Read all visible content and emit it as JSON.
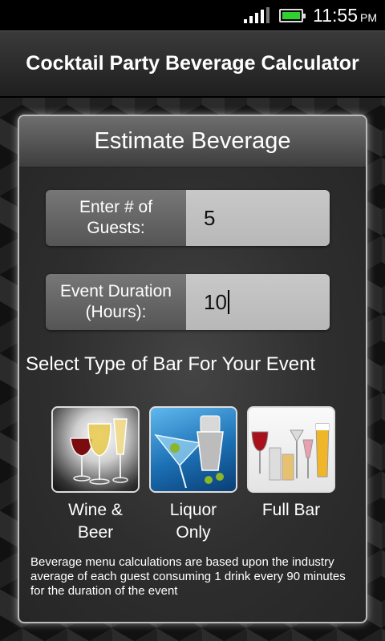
{
  "status_bar": {
    "time": "11:55",
    "ampm": "PM"
  },
  "app": {
    "title": "Cocktail Party Beverage Calculator"
  },
  "panel": {
    "header": "Estimate Beverage",
    "guests": {
      "label_line1": "Enter # of",
      "label_line2": "Guests:",
      "value": "5"
    },
    "duration": {
      "label_line1": "Event Duration",
      "label_line2": "(Hours):",
      "value": "10"
    },
    "section_heading": "Select Type of Bar For Your Event",
    "bar_options": [
      {
        "line1": "Wine &",
        "line2": "Beer"
      },
      {
        "line1": "Liquor",
        "line2": "Only"
      },
      {
        "line1": "Full Bar",
        "line2": ""
      }
    ],
    "footnote": "Beverage menu calculations are based upon the industry average of each guest consuming 1 drink every 90 minutes for the duration of the event"
  },
  "colors": {
    "battery": "#2fd12f",
    "panel_border": "#bbbbbb",
    "input_bg": "#c0c0c0"
  }
}
